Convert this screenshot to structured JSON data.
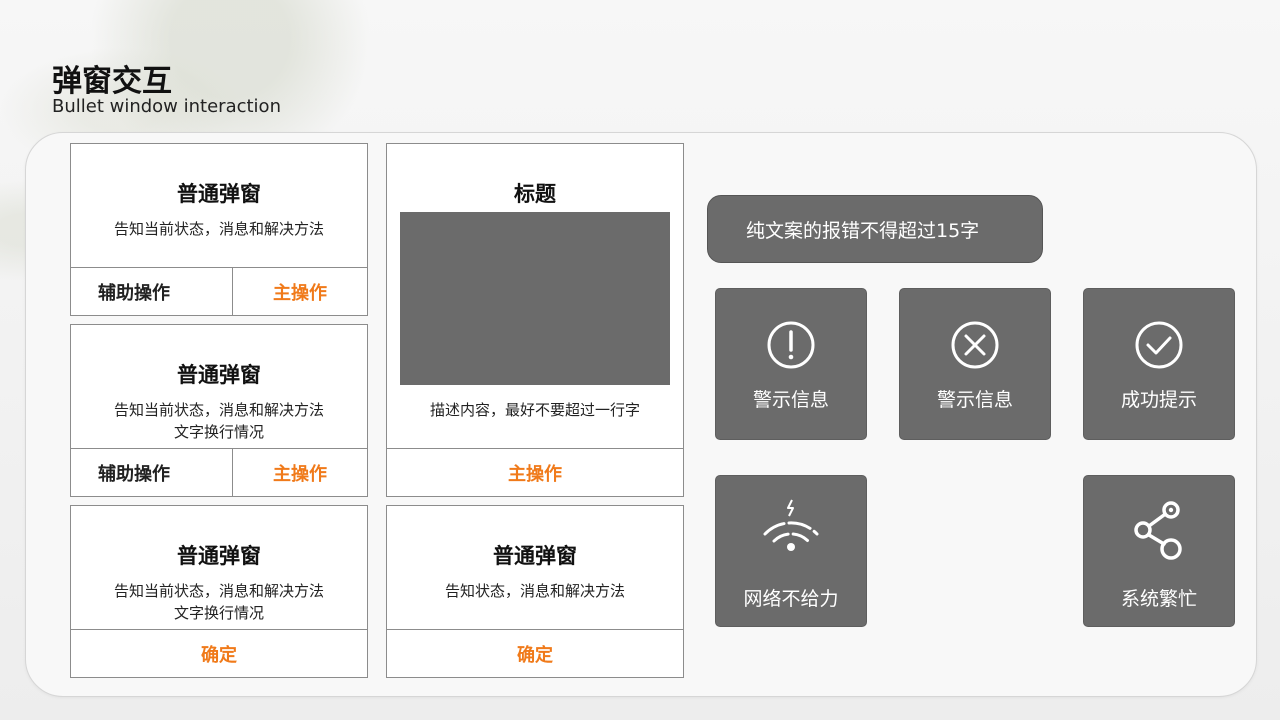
{
  "page": {
    "title": "弹窗交互",
    "subtitle": "Bullet window interaction"
  },
  "dialogs": {
    "d1": {
      "title": "普通弹窗",
      "text1": "告知当前状态，消息和解决方法",
      "secondary": "辅助操作",
      "primary": "主操作"
    },
    "d2": {
      "title": "普通弹窗",
      "text1": "告知当前状态，消息和解决方法",
      "text2": "文字换行情况",
      "secondary": "辅助操作",
      "primary": "主操作"
    },
    "d3": {
      "title": "普通弹窗",
      "text1": "告知当前状态，消息和解决方法",
      "text2": "文字换行情况",
      "confirm": "确定"
    },
    "d4": {
      "title": "标题",
      "text1": "描述内容，最好不要超过一行字",
      "primary": "主操作"
    },
    "d5": {
      "title": "普通弹窗",
      "text1": "告知状态，消息和解决方法",
      "confirm": "确定"
    }
  },
  "toasts": {
    "text_only": "纯文案的报错不得超过15字",
    "warning1": {
      "label": "警示信息",
      "icon": "exclamation-icon"
    },
    "warning2": {
      "label": "警示信息",
      "icon": "close-circle-icon"
    },
    "success": {
      "label": "成功提示",
      "icon": "check-circle-icon"
    },
    "network": {
      "label": "网络不给力",
      "icon": "wifi-weak-icon"
    },
    "busy": {
      "label": "系统繁忙",
      "icon": "share-nodes-icon"
    }
  },
  "colors": {
    "accent": "#f07a1a",
    "toast_bg": "#6b6b6b",
    "border": "#8c8c8c"
  }
}
